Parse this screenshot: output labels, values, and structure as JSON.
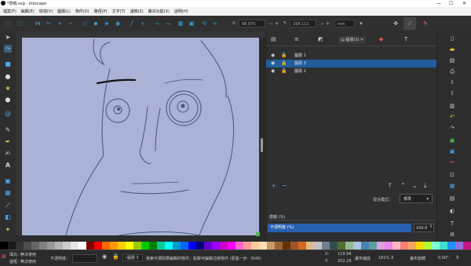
{
  "title": "*草稿.svg - Inkscape",
  "window_controls": [
    "—",
    "☐",
    "✕"
  ],
  "menu": [
    "檔案(F)",
    "編輯(E)",
    "檢視(V)",
    "圖層(L)",
    "物件(O)",
    "路徑(P)",
    "文字(T)",
    "濾鏡(S)",
    "擴充功能(X)",
    "說明(H)"
  ],
  "toolbar": {
    "x_label": "X:",
    "x_value": "98.075",
    "y_label": "Y:",
    "y_value": "168.111",
    "unit": "mm"
  },
  "layers_panel": {
    "tab_label": "圖層(S)",
    "layers": [
      {
        "name": "圖層 1",
        "visible": true,
        "locked": false,
        "selected": false
      },
      {
        "name": "圖層 3",
        "visible": true,
        "locked": false,
        "selected": true
      },
      {
        "name": "圖層 2",
        "visible": true,
        "locked": false,
        "selected": false
      }
    ],
    "add": "+",
    "remove": "−",
    "blend_label": "混合模式：",
    "blend_value": "標準",
    "opacity_title": "模糊 (%)",
    "opacity_label": "不透明度 (%)",
    "opacity_value": "100.0"
  },
  "status": {
    "fill_label": "填充：",
    "fill_value": "無法使用",
    "stroke_label": "邊框：",
    "stroke_value": "無法使用",
    "opacity_label": "不透明度：",
    "layer_value": "•圖層 3",
    "message": "按索可選取要編輯的物件；點擊可編輯這條物件 (更進一步：Shift)",
    "x_label": "X:",
    "x_value": "119.56",
    "y_label": "Y:",
    "y_value": "202.29",
    "zoom_label": "畫布縮放",
    "zoom_value": "181%",
    "rotate_label": "畫布旋轉",
    "rotate_value": "0.00°"
  },
  "colors": {
    "accent": "#215d9c",
    "canvas": "#aab2d6",
    "palette": [
      "#000000",
      "#1a1a1a",
      "#333333",
      "#4d4d4d",
      "#666666",
      "#808080",
      "#999999",
      "#b3b3b3",
      "#cccccc",
      "#e6e6e6",
      "#ffffff",
      "#800000",
      "#ff0000",
      "#ff6600",
      "#ff9900",
      "#ffcc00",
      "#ffff00",
      "#99cc00",
      "#00cc00",
      "#008000",
      "#00cc99",
      "#00ffff",
      "#0099cc",
      "#0066ff",
      "#0000ff",
      "#000080",
      "#6600cc",
      "#9900ff",
      "#cc00cc",
      "#ff00ff",
      "#ff66cc",
      "#ff9999",
      "#ffcc99",
      "#ffe0b3",
      "#cc9966",
      "#996633",
      "#663300",
      "#a0522d",
      "#d2691e",
      "#deb887",
      "#c0c0c0",
      "#708090",
      "#2f4f4f",
      "#556b2f",
      "#8fbc8f",
      "#b0c4de",
      "#4682b4",
      "#5f9ea0",
      "#dda0dd",
      "#ee82ee",
      "#ffb6c1",
      "#fa8072",
      "#f4a460",
      "#ffd700",
      "#adff2f",
      "#7fffd4",
      "#40e0d0",
      "#1e90ff",
      "#9370db",
      "#c71585"
    ]
  }
}
